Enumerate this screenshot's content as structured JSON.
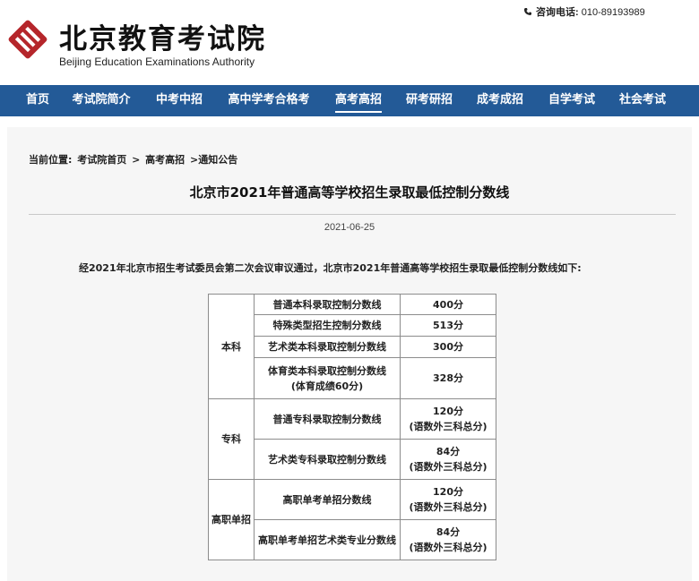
{
  "header": {
    "logo_cn": "北京教育考试院",
    "logo_en": "Beijing Education Examinations Authority",
    "hotline_label": "咨询电话:",
    "hotline_number": "010-89193989",
    "logo_color": "#b5262b"
  },
  "nav": {
    "items": [
      {
        "label": "首页"
      },
      {
        "label": "考试院简介"
      },
      {
        "label": "中考中招"
      },
      {
        "label": "高中学考合格考"
      },
      {
        "label": "高考高招",
        "active": true
      },
      {
        "label": "研考研招"
      },
      {
        "label": "成考成招"
      },
      {
        "label": "自学考试"
      },
      {
        "label": "社会考试"
      }
    ],
    "background": "#235a97"
  },
  "breadcrumb": {
    "label": "当前位置:",
    "items": [
      "考试院首页",
      ">",
      "高考高招",
      ">通知公告"
    ]
  },
  "article": {
    "title": "北京市2021年普通高等学校招生录取最低控制分数线",
    "date": "2021-06-25",
    "intro": "经2021年北京市招生考试委员会第二次会议审议通过，北京市2021年普通高等学校招生录取最低控制分数线如下:"
  },
  "table": {
    "groups": [
      {
        "category": "本科",
        "rows": [
          {
            "item": "普通本科录取控制分数线",
            "score": "400分"
          },
          {
            "item": "特殊类型招生控制分数线",
            "score": "513分"
          },
          {
            "item": "艺术类本科录取控制分数线",
            "score": "300分"
          },
          {
            "item": "体育类本科录取控制分数线",
            "item_note": "(体育成绩60分)",
            "score": "328分"
          }
        ]
      },
      {
        "category": "专科",
        "rows": [
          {
            "item": "普通专科录取控制分数线",
            "score": "120分",
            "score_note": "(语数外三科总分)"
          },
          {
            "item": "艺术类专科录取控制分数线",
            "score": "84分",
            "score_note": "(语数外三科总分)"
          }
        ]
      },
      {
        "category": "高职单招",
        "rows": [
          {
            "item": "高职单考单招分数线",
            "score": "120分",
            "score_note": "(语数外三科总分)"
          },
          {
            "item": "高职单考单招艺术类专业分数线",
            "score": "84分",
            "score_note": "(语数外三科总分)"
          }
        ]
      }
    ]
  }
}
